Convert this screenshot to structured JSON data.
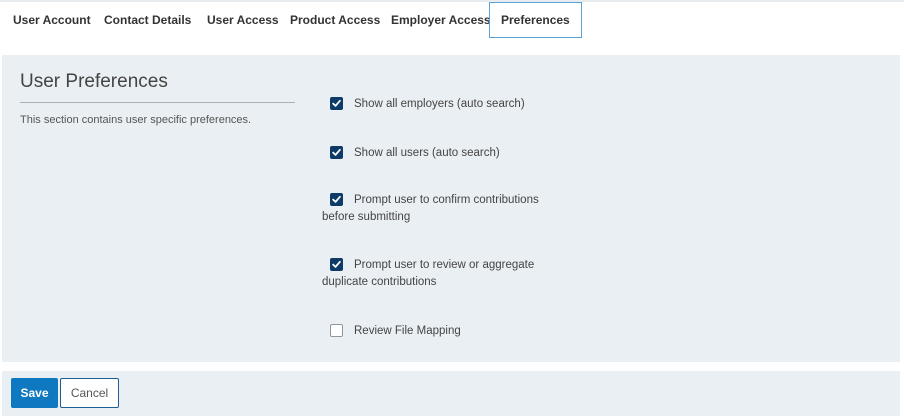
{
  "tabs": [
    {
      "label": "User Account"
    },
    {
      "label": "Contact Details"
    },
    {
      "label": "User Access"
    },
    {
      "label": "Product Access"
    },
    {
      "label": "Employer Access"
    },
    {
      "label": "Preferences",
      "active": true
    }
  ],
  "section": {
    "title": "User Preferences",
    "description": "This section contains user specific preferences."
  },
  "preferences": [
    {
      "label": "Show all employers (auto search)",
      "checked": true
    },
    {
      "label": "Show all users (auto search)",
      "checked": true
    },
    {
      "label": "Prompt user to confirm contributions before submitting",
      "checked": true
    },
    {
      "label": "Prompt user to review or aggregate duplicate contributions",
      "checked": true
    },
    {
      "label": "Review File Mapping",
      "checked": false
    }
  ],
  "footer": {
    "save_label": "Save",
    "cancel_label": "Cancel"
  },
  "colors": {
    "panel_bg": "#eaeff3",
    "checkbox_checked": "#0d3a66",
    "save_button": "#0e78c0",
    "active_tab_border": "#5aa3d6"
  }
}
